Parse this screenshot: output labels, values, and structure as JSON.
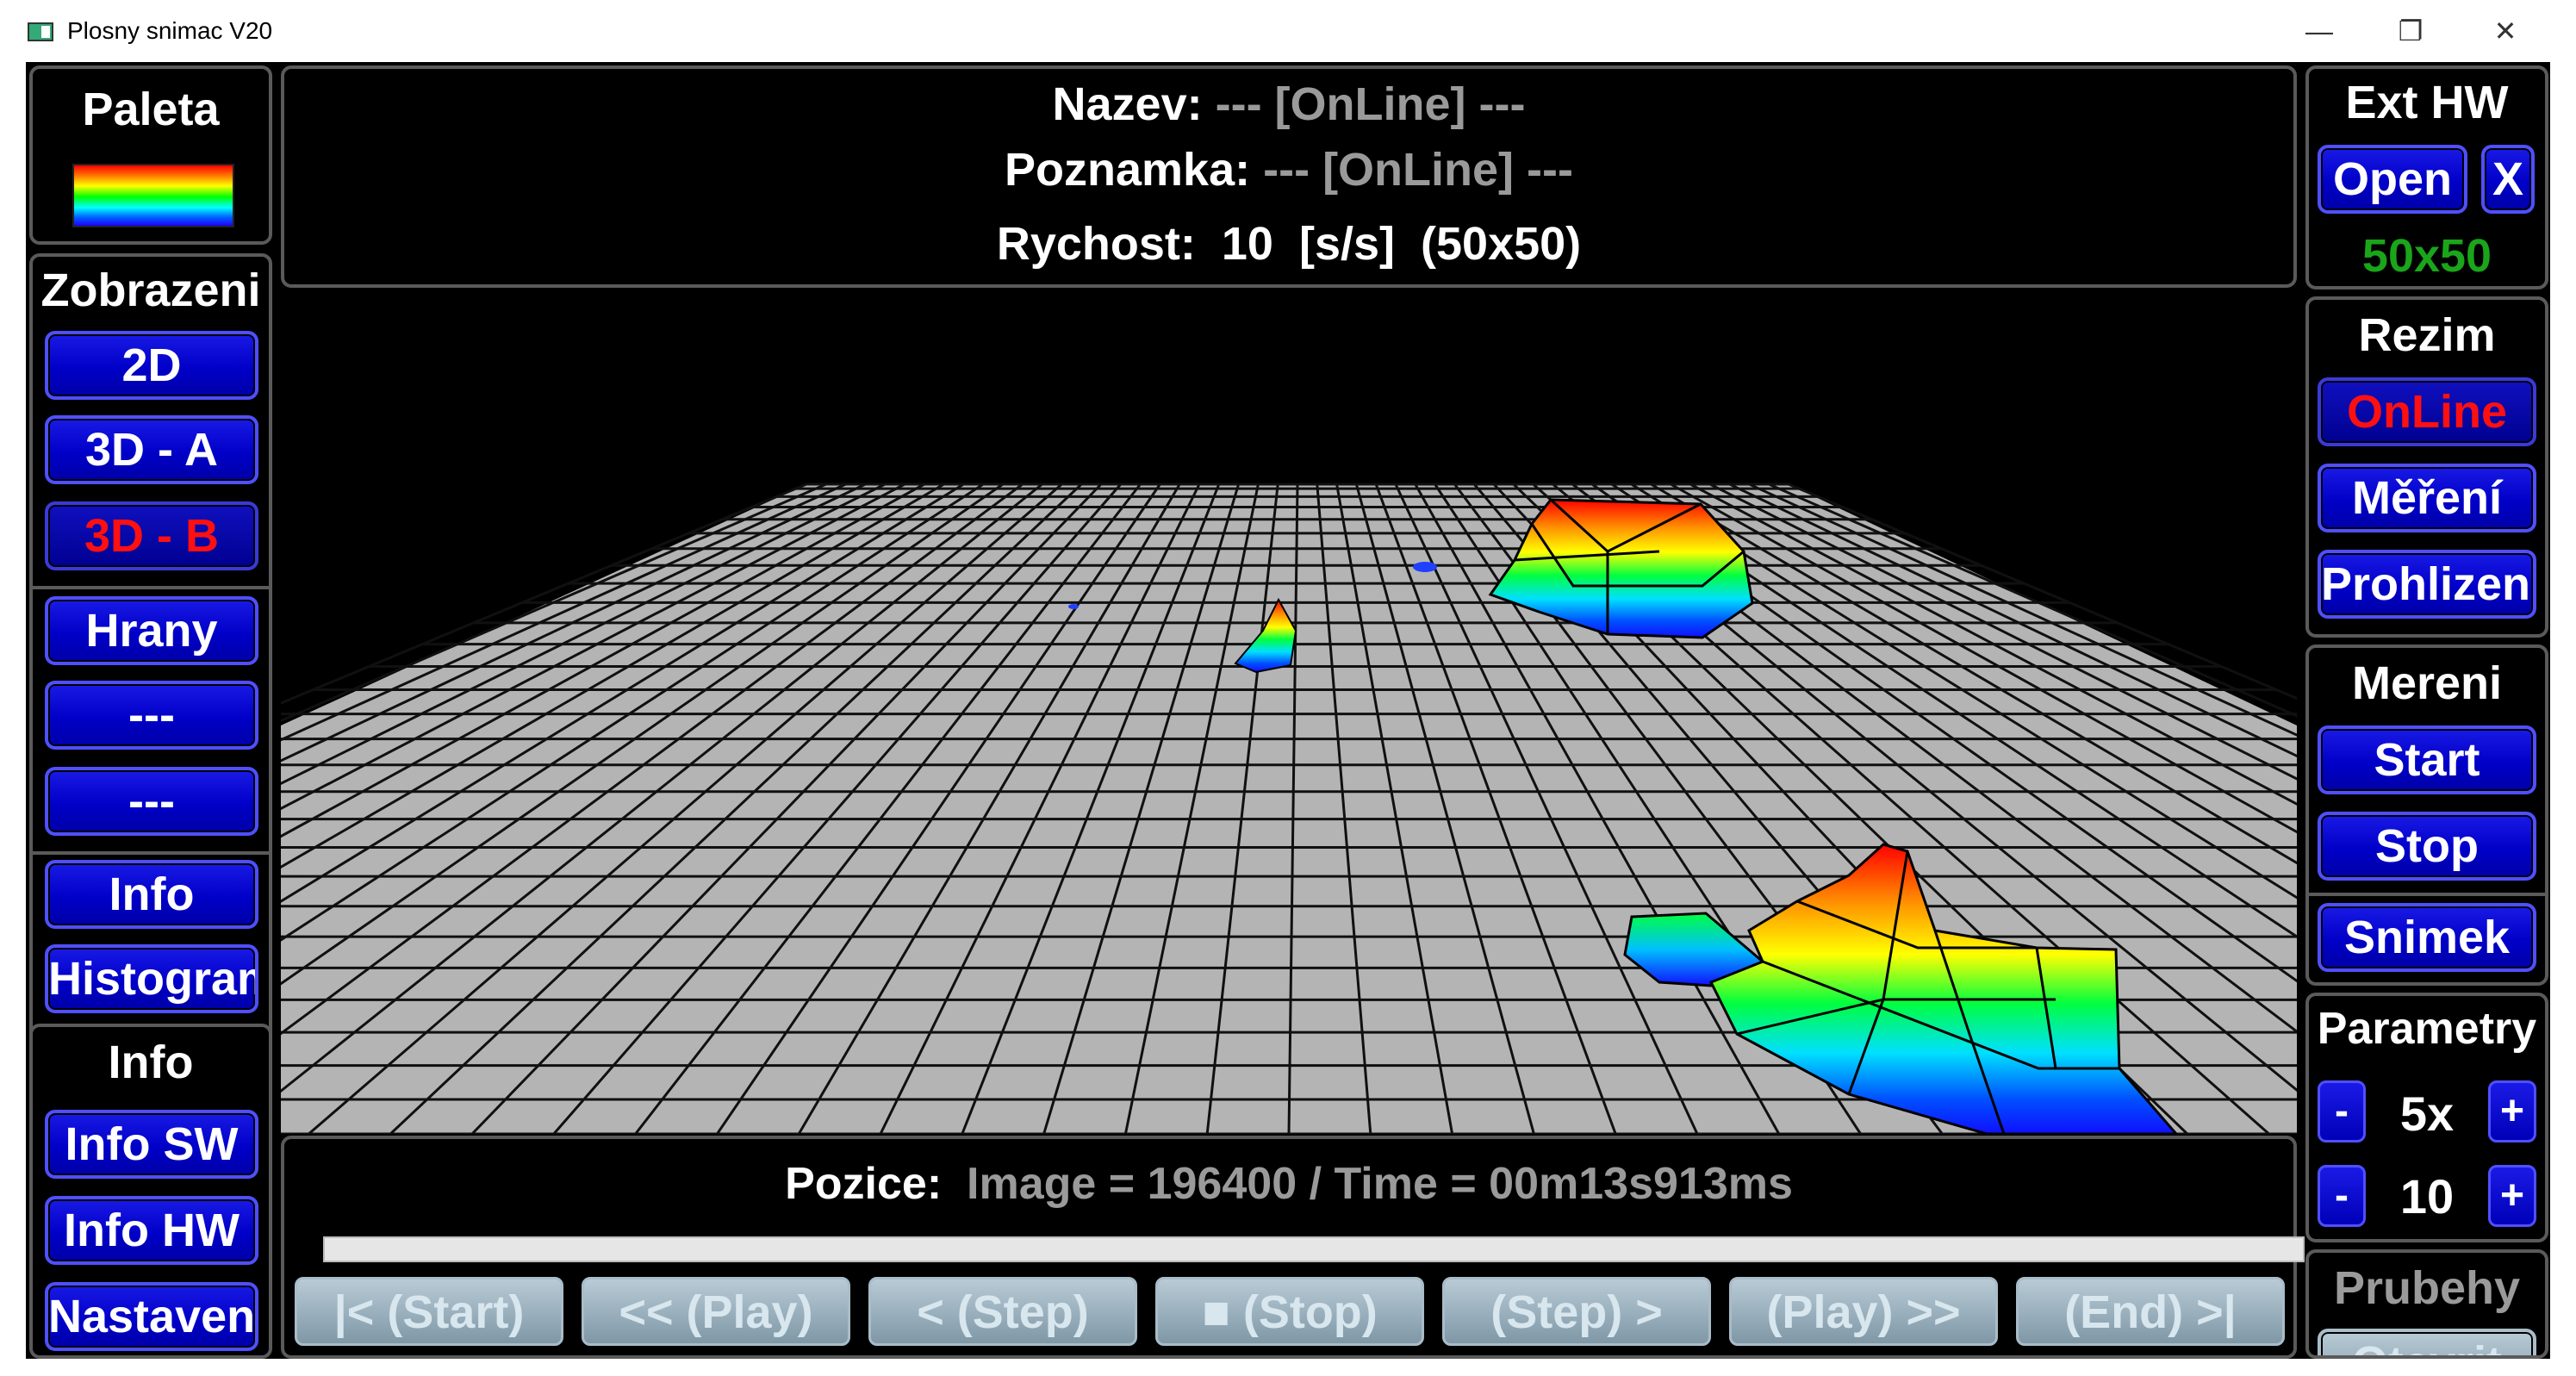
{
  "window": {
    "title": "Plosny snimac V20",
    "controls": {
      "minimize": "—",
      "restore": "❐",
      "close": "✕"
    }
  },
  "left": {
    "palette": {
      "title": "Paleta"
    },
    "display": {
      "title": "Zobrazeni",
      "buttons": [
        "2D",
        "3D - A",
        "3D - B",
        "Hrany",
        "---",
        "---",
        "Info",
        "Histogram"
      ],
      "active_index": 2
    },
    "info": {
      "title": "Info",
      "buttons": [
        "Info SW",
        "Info HW",
        "Nastaveni"
      ]
    }
  },
  "header": {
    "name_label": "Nazev:",
    "name_value": "--- [OnLine] ---",
    "note_label": "Poznamka:",
    "note_value": "--- [OnLine] ---",
    "speed_label": "Rychost:",
    "speed_value": "10",
    "speed_unit": "[s/s]",
    "resolution": "(50x50)"
  },
  "bottom": {
    "position_label": "Pozice:",
    "position_value": "Image = 196400 / Time = 00m13s913ms",
    "playback": [
      "|< (Start)",
      "<< (Play)",
      "< (Step)",
      "■ (Stop)",
      "(Step) >",
      "(Play) >>",
      "(End) >|"
    ]
  },
  "right": {
    "ext_hw": {
      "title": "Ext HW",
      "open": "Open",
      "close": "X",
      "size": "50x50"
    },
    "mode": {
      "title": "Rezim",
      "buttons": [
        "OnLine",
        "Měření",
        "Prohlizeni"
      ],
      "active_index": 0
    },
    "measure": {
      "title": "Mereni",
      "buttons": [
        "Start",
        "Stop",
        "Snimek"
      ]
    },
    "params": {
      "title": "Parametry",
      "minus": "-",
      "plus": "+",
      "value1": "5x",
      "value2": "10"
    },
    "curves": {
      "title": "Prubehy",
      "open": "Otevrit"
    }
  },
  "colors": {
    "button_blue": "#0000c8",
    "active_red": "#ff1010",
    "ok_green": "#1aa51a",
    "panel_border": "#5a5a5a",
    "grid_gray": "#b4b4b4"
  },
  "plot": {
    "type": "3D surface",
    "grid": "50x50"
  }
}
